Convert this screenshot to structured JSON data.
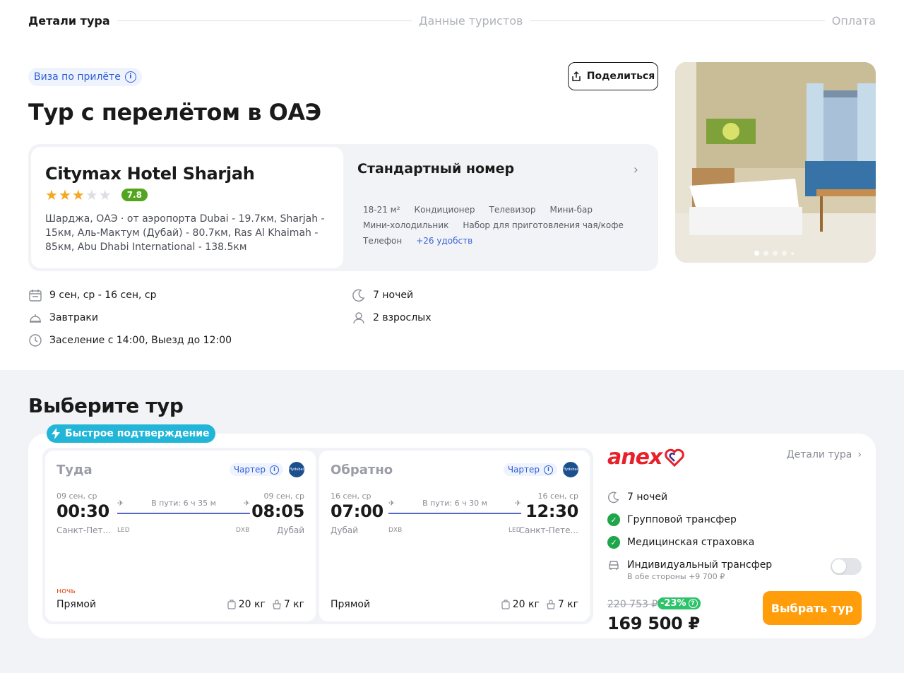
{
  "stepper": {
    "steps": [
      "Детали тура",
      "Данные туристов",
      "Оплата"
    ]
  },
  "visa": {
    "label": "Виза по прилёте"
  },
  "share": {
    "label": "Поделиться"
  },
  "title": "Тур с перелётом в ОАЭ",
  "hotel": {
    "name": "Citymax Hotel Sharjah",
    "stars": 3,
    "max_stars": 5,
    "rating": "7.8",
    "location": "Шарджа, ОАЭ · от аэропорта Dubai - 19.7км, Sharjah - 15км, Аль-Мактум (Дубай) - 80.7км, Ras Al Khaimah - 85км, Abu Dhabi International - 138.5км"
  },
  "room": {
    "title": "Стандартный номер",
    "amenities": [
      "18-21 м²",
      "Кондиционер",
      "Телевизор",
      "Мини-бар",
      "Мини-холодильник",
      "Набор для приготовления чая/кофе",
      "Телефон"
    ],
    "more": "+26 удобств"
  },
  "photo": {
    "total_dots": 5,
    "active_dot": 1
  },
  "details": {
    "dates": "9 сен, ср - 16 сен, ср",
    "nights": "7 ночей",
    "meals": "Завтраки",
    "guests": "2 взрослых",
    "checkin": "Заселение с 14:00, Выезд до 12:00"
  },
  "select_tour": {
    "title": "Выберите тур",
    "badge": "Быстрое подтверждение"
  },
  "outbound": {
    "direction": "Туда",
    "charter": "Чартер",
    "airline_logo_text": "flydubai",
    "dep_date": "09 сен, ср",
    "dep_time": "00:30",
    "dep_city": "Санкт-Пет...",
    "dep_code": "LED",
    "duration": "В пути: 6 ч 35 м",
    "arr_date": "09 сен, ср",
    "arr_time": "08:05",
    "arr_city": "Дубай",
    "arr_code": "DXB",
    "night_label": "ночь",
    "type": "Прямой",
    "baggage": "20 кг",
    "hand_luggage": "7 кг"
  },
  "return": {
    "direction": "Обратно",
    "charter": "Чартер",
    "airline_logo_text": "flydubai",
    "dep_date": "16 сен, ср",
    "dep_time": "07:00",
    "dep_city": "Дубай",
    "dep_code": "DXB",
    "duration": "В пути: 6 ч 30 м",
    "arr_date": "16 сен, ср",
    "arr_time": "12:30",
    "arr_city": "Санкт-Пете...",
    "arr_code": "LED",
    "type": "Прямой",
    "baggage": "20 кг",
    "hand_luggage": "7 кг"
  },
  "offer": {
    "operator": "anex",
    "details_link": "Детали тура",
    "nights": "7 ночей",
    "group_transfer": "Групповой трансфер",
    "insurance": "Медицинская страховка",
    "individual_transfer": "Индивидуальный трансфер",
    "individual_transfer_price": "В обе стороны +9 700 ₽",
    "old_price": "220 753 ₽",
    "discount": "-23%",
    "price": "169 500 ₽",
    "button": "Выбрать тур"
  },
  "colors": {
    "accent_orange": "#ff9d0a",
    "anex_red": "#e8202a",
    "link_blue": "#2f5fd6",
    "success_green": "#1fa54a",
    "fast_badge": "#21b5d8",
    "rating_green": "#52a51d"
  }
}
